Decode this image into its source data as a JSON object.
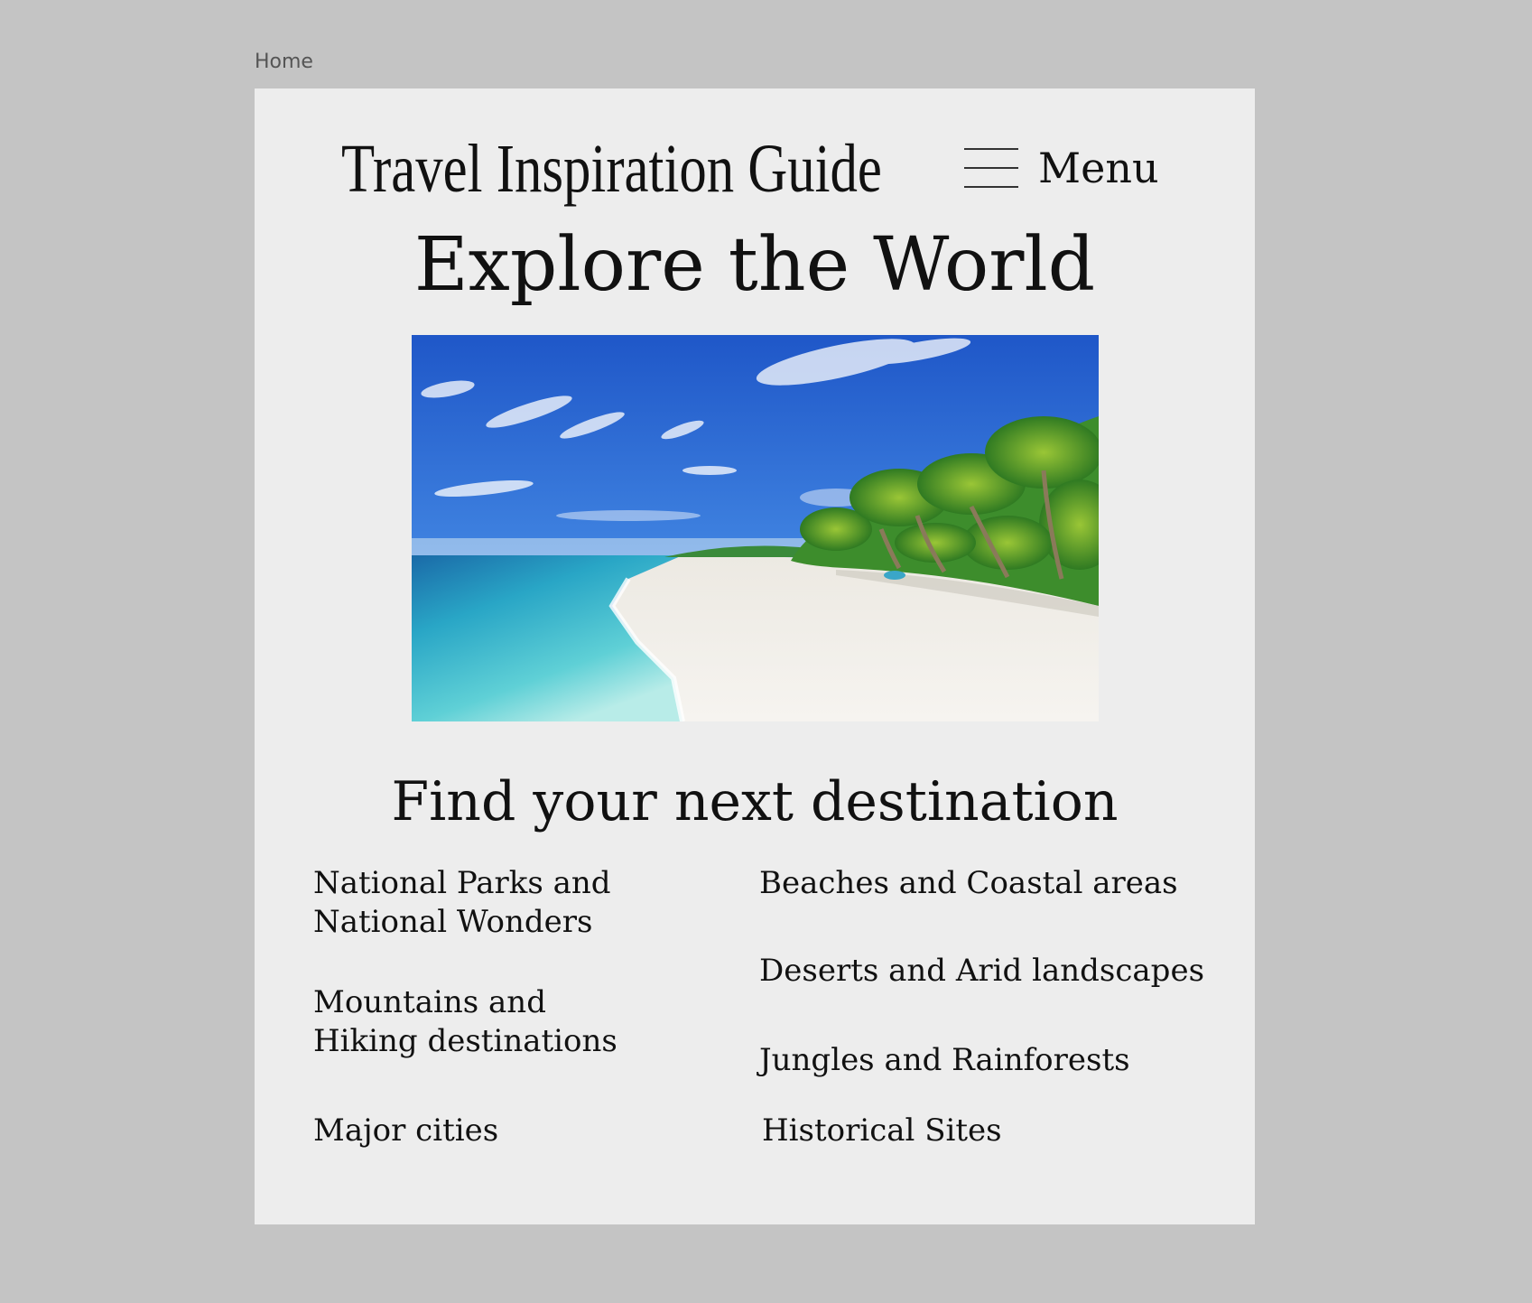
{
  "frame": {
    "label": "Home"
  },
  "header": {
    "site_title": "Travel Inspiration Guide",
    "menu_label": "Menu",
    "menu_icon": "hamburger-icon"
  },
  "hero": {
    "heading": "Explore the World",
    "image": "beach-palm-trees-image"
  },
  "destinations": {
    "heading": "Find your next destination",
    "left_column": [
      "National Parks and\nNational Wonders",
      "Mountains and\nHiking destinations",
      "Major cities"
    ],
    "right_column": [
      "Beaches and Coastal areas",
      "Deserts and Arid landscapes",
      "Jungles and Rainforests",
      "Historical Sites"
    ]
  },
  "colors": {
    "canvas": "#c4c4c4",
    "frame": "#ededed",
    "text": "#111111"
  }
}
